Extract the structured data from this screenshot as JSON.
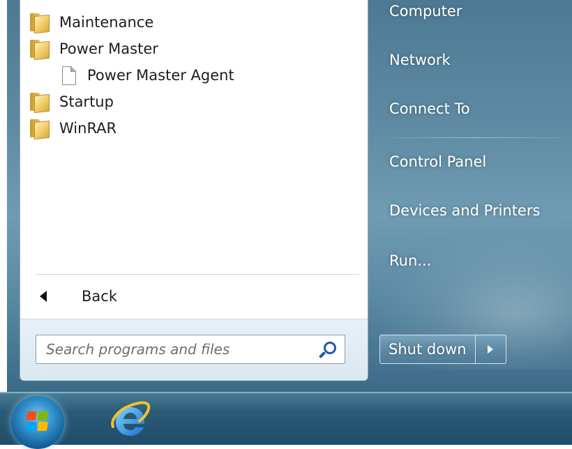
{
  "programs": [
    {
      "label": "Maintenance",
      "icon": "folder-icon",
      "indent": false
    },
    {
      "label": "Power Master",
      "icon": "folder-icon",
      "indent": false
    },
    {
      "label": "Power Master Agent",
      "icon": "document-icon",
      "indent": true
    },
    {
      "label": "Startup",
      "icon": "folder-icon",
      "indent": false
    },
    {
      "label": "WinRAR",
      "icon": "folder-icon",
      "indent": false
    }
  ],
  "back_label": "Back",
  "search": {
    "placeholder": "Search programs and files",
    "value": ""
  },
  "right_items": [
    {
      "label": "Computer"
    },
    {
      "label": "Network"
    },
    {
      "label": "Connect To"
    },
    {
      "label": "Control Panel"
    },
    {
      "label": "Devices and Printers"
    },
    {
      "label": "Run..."
    }
  ],
  "shutdown": {
    "label": "Shut down"
  },
  "taskbar": {
    "start_button": "windows-start-orb",
    "pinned": [
      "internet-explorer-icon"
    ]
  },
  "colors": {
    "menu_blue": "#5d8aa2",
    "taskbar": "#2b5b77",
    "search_icon": "#1d57a8"
  }
}
